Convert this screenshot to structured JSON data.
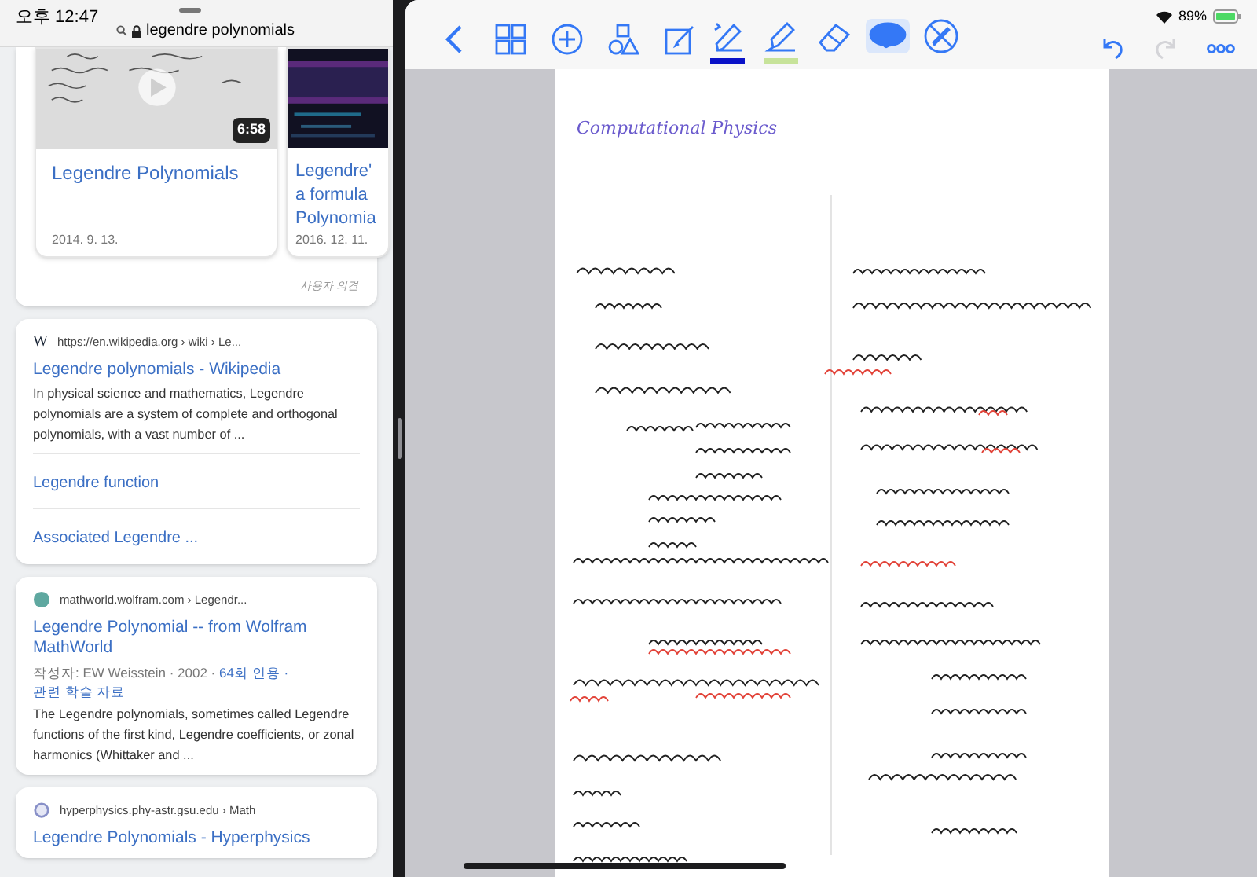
{
  "status_bar": {
    "time": "오후 12:47",
    "battery": "89%"
  },
  "browser": {
    "url": "legendre polynomials",
    "videos": [
      {
        "title_lines": [
          "Legendre Polynomials"
        ],
        "date": "2014. 9. 13.",
        "duration": "6:58",
        "kind": "light"
      },
      {
        "title_lines": [
          "Legendre'",
          "a formula",
          "Polynomia"
        ],
        "date": "2016. 12. 11.",
        "kind": "dark"
      }
    ],
    "feedback": "사용자 의견",
    "results": [
      {
        "kind": "wikipedia",
        "icon_text": "W",
        "source": "https://en.wikipedia.org › wiki › Le...",
        "title": "Legendre polynomials - Wikipedia",
        "snippet": "In physical science and mathematics, Legendre polynomials are a system of complete and orthogonal polynomials, with a vast number of ...",
        "sublinks": [
          "Legendre function",
          "Associated Legendre ..."
        ]
      },
      {
        "kind": "globe",
        "source": "mathworld.wolfram.com › Legendr...",
        "title": "Legendre Polynomial -- from Wolfram MathWorld",
        "meta": "작성자: EW Weisstein · 2002 · ",
        "meta_links": [
          "64회 인용",
          "관련 학술 자료"
        ],
        "separator": "·",
        "snippet": "The Legendre polynomials, sometimes called Legendre functions of the first kind, Legendre coefficients, or zonal harmonics (Whittaker and ..."
      },
      {
        "kind": "ring",
        "source": "hyperphysics.phy-astr.gsu.edu › Math",
        "title": "Legendre Polynomials - Hyperphysics"
      }
    ]
  },
  "notes": {
    "tools": [
      {
        "kind": "back",
        "selected": false
      },
      {
        "kind": "grid",
        "selected": false
      },
      {
        "kind": "add",
        "selected": false
      },
      {
        "kind": "shapes",
        "selected": false
      },
      {
        "kind": "edit",
        "selected": false
      },
      {
        "kind": "pen",
        "selected": false,
        "color": "#0a12c8"
      },
      {
        "kind": "highlighter",
        "selected": false,
        "color": "#c7e39a"
      },
      {
        "kind": "eraser",
        "selected": false
      },
      {
        "kind": "lasso",
        "selected": true
      },
      {
        "kind": "no-pen",
        "selected": false
      }
    ],
    "actions": [
      {
        "kind": "undo",
        "disabled": false
      },
      {
        "kind": "redo",
        "disabled": true
      },
      {
        "kind": "more",
        "disabled": false
      }
    ],
    "page_title": "Computational Physics"
  }
}
